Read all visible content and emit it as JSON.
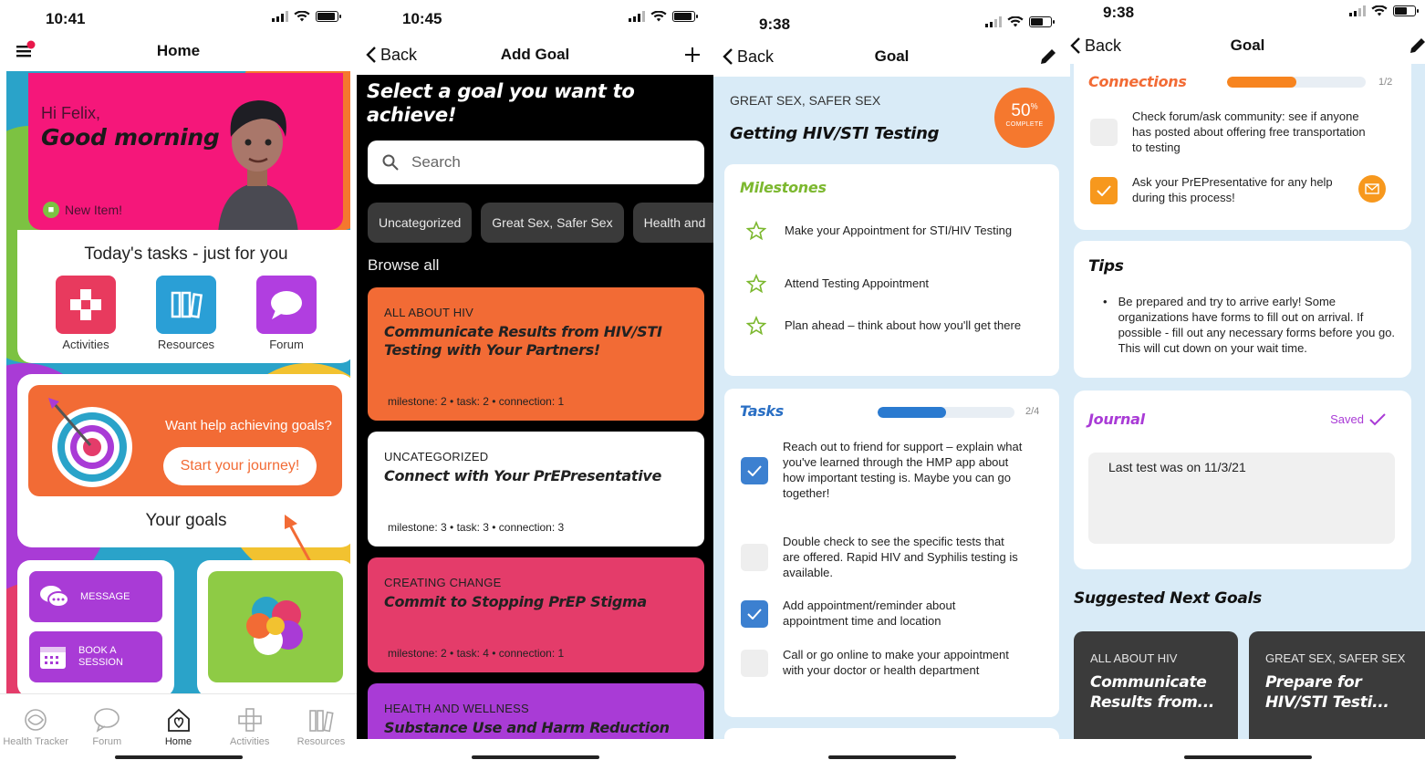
{
  "home": {
    "status_time": "10:41",
    "nav_title": "Home",
    "greeting": "Hi Felix,",
    "greeting_big": "Good morning",
    "new_item": "New Item!",
    "tasks_heading": "Today's tasks - just for you",
    "tiles": [
      {
        "label": "Activities",
        "icon": "puzzle-icon",
        "color": "#e83a5e"
      },
      {
        "label": "Resources",
        "icon": "books-icon",
        "color": "#2a9fd6"
      },
      {
        "label": "Forum",
        "icon": "chat-bubble-icon",
        "color": "#b13ee0"
      }
    ],
    "goals_prompt": "Want help achieving goals?",
    "goals_button": "Start your journey!",
    "goals_heading": "Your goals",
    "message_btn": "MESSAGE",
    "book_btn": "BOOK A SESSION",
    "tabs": [
      {
        "label": "Health Tracker",
        "icon": "health-tracker-icon",
        "active": false
      },
      {
        "label": "Forum",
        "icon": "forum-icon",
        "active": false
      },
      {
        "label": "Home",
        "icon": "home-icon",
        "active": true
      },
      {
        "label": "Activities",
        "icon": "activities-icon",
        "active": false
      },
      {
        "label": "Resources",
        "icon": "resources-icon",
        "active": false
      }
    ]
  },
  "add_goal": {
    "status_time": "10:45",
    "back": "Back",
    "nav_title": "Add Goal",
    "prompt": "Select a goal you want to achieve!",
    "search_placeholder": "Search",
    "chips": [
      "Uncategorized",
      "Great Sex, Safer Sex",
      "Health and"
    ],
    "browse_heading": "Browse all",
    "goals": [
      {
        "category": "ALL ABOUT HIV",
        "title": "Communicate Results from HIV/STI Testing with Your Partners!",
        "meta": "milestone: 2 • task: 2 • connection: 1",
        "color": "#f26b35",
        "text_color": "#111"
      },
      {
        "category": "UNCATEGORIZED",
        "title": "Connect with Your PrEPresentative",
        "meta": "milestone: 3 • task: 3 • connection: 3",
        "color": "#ffffff",
        "text_color": "#111"
      },
      {
        "category": "CREATING CHANGE",
        "title": "Commit to Stopping PrEP Stigma",
        "meta": "milestone: 2 • task: 4 • connection: 1",
        "color": "#e43c6a",
        "text_color": "#111"
      },
      {
        "category": "HEALTH AND WELLNESS",
        "title": "Substance Use and Harm Reduction",
        "meta": "",
        "color": "#a93bd6",
        "text_color": "#111"
      }
    ]
  },
  "goal": {
    "status_time": "9:38",
    "back": "Back",
    "nav_title": "Goal",
    "category": "GREAT SEX, SAFER SEX",
    "title": "Getting HIV/STI Testing",
    "progress_percent": "50",
    "progress_suffix": "%",
    "progress_label": "COMPLETE",
    "milestones_heading": "Milestones",
    "milestones": [
      "Make your Appointment for STI/HIV Testing",
      "Attend Testing Appointment",
      "Plan ahead – think about how you'll get there"
    ],
    "tasks_heading": "Tasks",
    "tasks_count": "2/4",
    "tasks_progress": 0.5,
    "tasks": [
      {
        "text": "Reach out to friend for support – explain what you've learned through the HMP app about how important testing is. Maybe you can go together!",
        "done": true
      },
      {
        "text": "Double check to see the specific tests that are offered. Rapid HIV and Syphilis testing is available.",
        "done": false
      },
      {
        "text": "Add appointment/reminder about appointment time and location",
        "done": true
      },
      {
        "text": "Call or go online to make your appointment with your doctor or health department",
        "done": false
      }
    ]
  },
  "goal_scrolled": {
    "status_time": "9:38",
    "back": "Back",
    "nav_title": "Goal",
    "connections_heading": "Connections",
    "connections_count": "1/2",
    "connections_progress": 0.5,
    "connections": [
      {
        "text": "Check forum/ask community: see if anyone has posted about offering free transportation to testing",
        "done": false
      },
      {
        "text": "Ask your PrEPresentative for any help during this process!",
        "done": true
      }
    ],
    "tips_heading": "Tips",
    "tip": "Be prepared and try to arrive early! Some organizations have forms to fill out on arrival. If possible - fill out any necessary forms before you go. This will cut down on your wait time.",
    "journal_heading": "Journal",
    "journal_saved": "Saved",
    "journal_text": "Last test was on 11/3/21",
    "suggested_heading": "Suggested Next Goals",
    "suggested": [
      {
        "category": "ALL ABOUT HIV",
        "title": "Communicate Results from..."
      },
      {
        "category": "GREAT SEX, SAFER SEX",
        "title": "Prepare for HIV/STI Testi..."
      }
    ]
  }
}
